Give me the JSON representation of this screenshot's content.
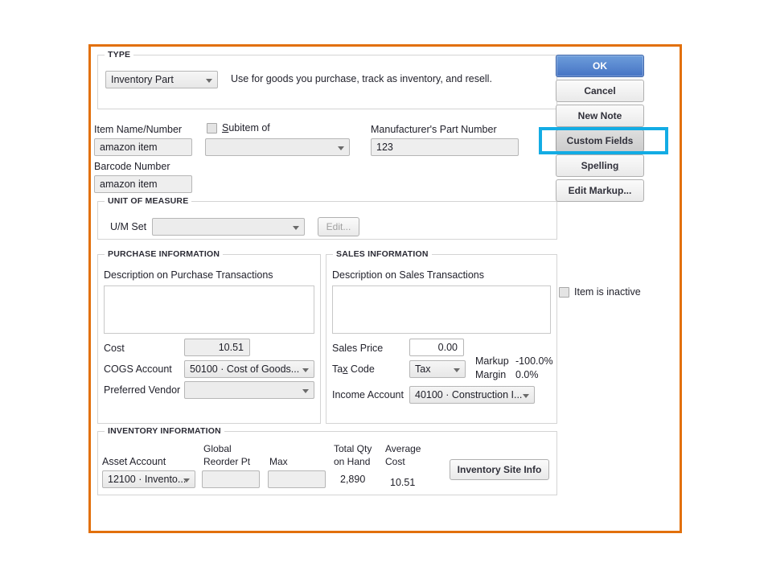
{
  "dialog": {
    "type_group": {
      "title": "TYPE",
      "type_value": "Inventory Part",
      "description": "Use for goods you purchase, track as inventory, and resell."
    },
    "identity": {
      "item_name_label": "Item Name/Number",
      "item_name_value": "amazon item",
      "subitem_label": "Subitem of",
      "subitem_value": "",
      "barcode_label": "Barcode Number",
      "barcode_value": "amazon item",
      "mpn_label": "Manufacturer's Part Number",
      "mpn_value": "123"
    },
    "unit_of_measure": {
      "title": "UNIT OF MEASURE",
      "um_set_label": "U/M Set",
      "um_set_value": "",
      "edit_button": "Edit..."
    },
    "purchase": {
      "title": "PURCHASE INFORMATION",
      "description_label": "Description on Purchase Transactions",
      "description_value": "",
      "cost_label": "Cost",
      "cost_value": "10.51",
      "cogs_label": "COGS Account",
      "cogs_value": "50100 · Cost of Goods...",
      "vendor_label": "Preferred Vendor",
      "vendor_value": ""
    },
    "sales": {
      "title": "SALES INFORMATION",
      "description_label": "Description on Sales Transactions",
      "description_value": "",
      "sales_price_label": "Sales Price",
      "sales_price_value": "0.00",
      "tax_code_label_pre": "Ta",
      "tax_code_label_key": "x",
      "tax_code_label_post": " Code",
      "tax_code_value": "Tax",
      "income_label": "Income Account",
      "income_value": "40100 · Construction I...",
      "markup_label": "Markup",
      "markup_value": "-100.0%",
      "margin_label": "Margin",
      "margin_value": "0.0%"
    },
    "inventory": {
      "title": "INVENTORY INFORMATION",
      "asset_account_label": "Asset Account",
      "asset_account_value": "12100 · Invento...",
      "reorder_label_line1": "Global",
      "reorder_label_line2": "Reorder Pt",
      "reorder_value": "",
      "max_label": "Max",
      "max_value": "",
      "total_qty_line1": "Total Qty",
      "total_qty_line2": "on Hand",
      "total_qty_value": "2,890",
      "avg_cost_line1": "Average",
      "avg_cost_line2": "Cost",
      "avg_cost_value": "10.51",
      "site_info_button": "Inventory Site Info"
    },
    "buttons": {
      "ok": "OK",
      "cancel": "Cancel",
      "new_note": "New Note",
      "custom_fields": "Custom Fields",
      "spelling_pre": "Spellin",
      "spelling_key": "g",
      "edit_markup": "Edit Markup..."
    },
    "inactive": {
      "label": "Item is inactive",
      "checked": false
    },
    "colors": {
      "frame_border": "#e2700c",
      "highlight": "#13ace4",
      "primary_button": "#4674c4"
    }
  }
}
